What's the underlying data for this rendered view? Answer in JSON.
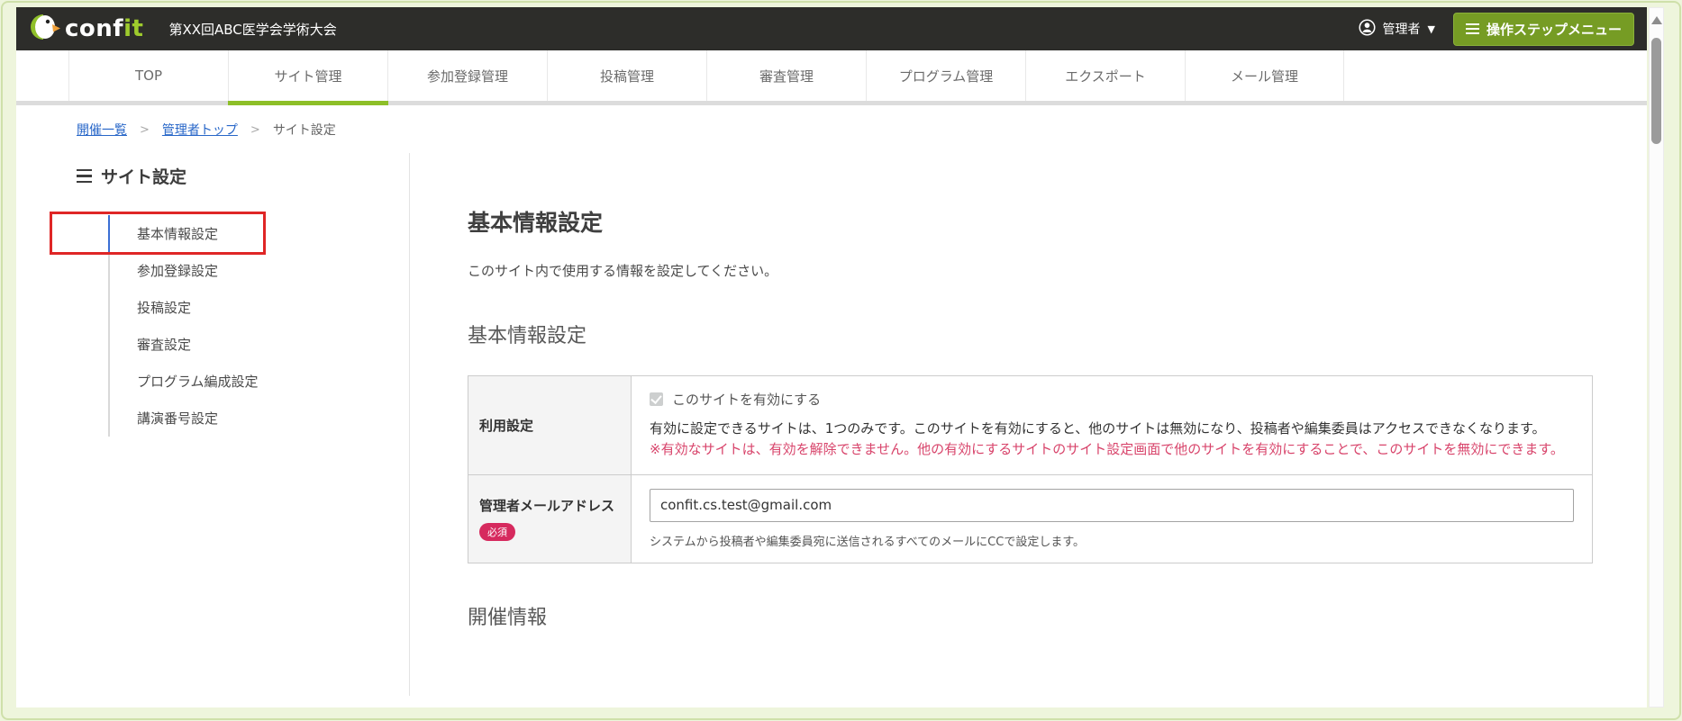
{
  "header": {
    "logo_conf": "conf",
    "logo_it": "it",
    "event_title": "第XX回ABC医学会学術大会",
    "user_label": "管理者",
    "user_caret": "▼",
    "step_menu_label": "操作ステップメニュー"
  },
  "nav": {
    "tabs": [
      {
        "label": "TOP",
        "active": false
      },
      {
        "label": "サイト管理",
        "active": true
      },
      {
        "label": "参加登録管理",
        "active": false
      },
      {
        "label": "投稿管理",
        "active": false
      },
      {
        "label": "審査管理",
        "active": false
      },
      {
        "label": "プログラム管理",
        "active": false
      },
      {
        "label": "エクスポート",
        "active": false
      },
      {
        "label": "メール管理",
        "active": false
      }
    ]
  },
  "breadcrumb": {
    "separator": ">",
    "items": [
      {
        "label": "開催一覧"
      },
      {
        "label": "管理者トップ"
      },
      {
        "label": "サイト設定"
      }
    ]
  },
  "sidebar": {
    "title": "サイト設定",
    "items": [
      {
        "label": "基本情報設定",
        "active": true,
        "highlighted": true
      },
      {
        "label": "参加登録設定",
        "active": false
      },
      {
        "label": "投稿設定",
        "active": false
      },
      {
        "label": "審査設定",
        "active": false
      },
      {
        "label": "プログラム編成設定",
        "active": false
      },
      {
        "label": "講演番号設定",
        "active": false
      }
    ]
  },
  "main": {
    "page_title": "基本情報設定",
    "page_description": "このサイト内で使用する情報を設定してください。",
    "section1_title": "基本情報設定",
    "usage_row": {
      "label": "利用設定",
      "checkbox_label": "このサイトを有効にする",
      "checkbox_checked": true,
      "description": "有効に設定できるサイトは、1つのみです。このサイトを有効にすると、他のサイトは無効になり、投稿者や編集委員はアクセスできなくなります。",
      "warning": "※有効なサイトは、有効を解除できません。他の有効にするサイトのサイト設定画面で他のサイトを有効にすることで、このサイトを無効にできます。"
    },
    "email_row": {
      "label": "管理者メールアドレス",
      "badge": "必須",
      "input_value": "confit.cs.test@gmail.com",
      "helper": "システムから投稿者や編集委員宛に送信されるすべてのメールにCCで設定します。"
    },
    "section2_title": "開催情報"
  },
  "colors": {
    "header_bg": "#2d2d2a",
    "brand_green": "#9ecb2d",
    "button_green": "#769c24",
    "active_tab_underline": "#8dbf28",
    "link_blue": "#2766c8",
    "active_item_blue": "#3b6fd4",
    "annotation_red": "#df2626",
    "required_badge_red": "#d62a5e",
    "warning_text_red": "#d8446b"
  }
}
